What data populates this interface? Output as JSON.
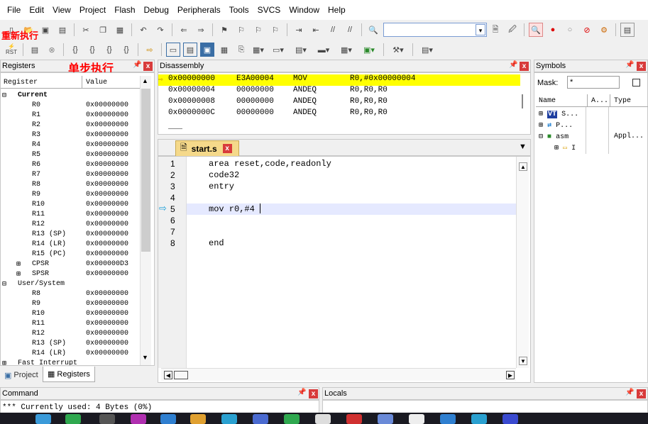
{
  "menu": [
    "File",
    "Edit",
    "View",
    "Project",
    "Flash",
    "Debug",
    "Peripherals",
    "Tools",
    "SVCS",
    "Window",
    "Help"
  ],
  "annotations": {
    "reset_run": "重新执行",
    "single_step": "单步执行"
  },
  "toolbar2": {
    "rst_label": "RST"
  },
  "registers_panel": {
    "title": "Registers",
    "col_register": "Register",
    "col_value": "Value",
    "groups": [
      {
        "label": "Current",
        "rows": [
          {
            "name": "R0",
            "value": "0x00000000"
          },
          {
            "name": "R1",
            "value": "0x00000000"
          },
          {
            "name": "R2",
            "value": "0x00000000"
          },
          {
            "name": "R3",
            "value": "0x00000000"
          },
          {
            "name": "R4",
            "value": "0x00000000"
          },
          {
            "name": "R5",
            "value": "0x00000000"
          },
          {
            "name": "R6",
            "value": "0x00000000"
          },
          {
            "name": "R7",
            "value": "0x00000000"
          },
          {
            "name": "R8",
            "value": "0x00000000"
          },
          {
            "name": "R9",
            "value": "0x00000000"
          },
          {
            "name": "R10",
            "value": "0x00000000"
          },
          {
            "name": "R11",
            "value": "0x00000000"
          },
          {
            "name": "R12",
            "value": "0x00000000"
          },
          {
            "name": "R13 (SP)",
            "value": "0x00000000"
          },
          {
            "name": "R14 (LR)",
            "value": "0x00000000"
          },
          {
            "name": "R15 (PC)",
            "value": "0x00000000"
          },
          {
            "name": "CPSR",
            "value": "0x000000D3"
          },
          {
            "name": "SPSR",
            "value": "0x00000000"
          }
        ]
      },
      {
        "label": "User/System",
        "rows": [
          {
            "name": "R8",
            "value": "0x00000000"
          },
          {
            "name": "R9",
            "value": "0x00000000"
          },
          {
            "name": "R10",
            "value": "0x00000000"
          },
          {
            "name": "R11",
            "value": "0x00000000"
          },
          {
            "name": "R12",
            "value": "0x00000000"
          },
          {
            "name": "R13 (SP)",
            "value": "0x00000000"
          },
          {
            "name": "R14 (LR)",
            "value": "0x00000000"
          }
        ]
      },
      {
        "label": "Fast Interrupt",
        "rows": []
      }
    ],
    "tabs": [
      "Project",
      "Registers"
    ]
  },
  "disassembly": {
    "title": "Disassembly",
    "rows": [
      {
        "addr": "0x00000000",
        "code": "E3A00004",
        "mnemonic": "MOV",
        "operands": "R0,#0x00000004",
        "current": true
      },
      {
        "addr": "0x00000004",
        "code": "00000000",
        "mnemonic": "ANDEQ",
        "operands": "R0,R0,R0",
        "current": false
      },
      {
        "addr": "0x00000008",
        "code": "00000000",
        "mnemonic": "ANDEQ",
        "operands": "R0,R0,R0",
        "current": false
      },
      {
        "addr": "0x0000000C",
        "code": "00000000",
        "mnemonic": "ANDEQ",
        "operands": "R0,R0,R0",
        "current": false
      }
    ]
  },
  "editor": {
    "tab_name": "start.s",
    "lines": [
      {
        "num": "1",
        "text": "area reset,code,readonly"
      },
      {
        "num": "2",
        "text": "code32"
      },
      {
        "num": "3",
        "text": "entry"
      },
      {
        "num": "4",
        "text": ""
      },
      {
        "num": "5",
        "text": "mov r0,#4"
      },
      {
        "num": "6",
        "text": ""
      },
      {
        "num": "7",
        "text": ""
      },
      {
        "num": "8",
        "text": "end"
      }
    ]
  },
  "symbols": {
    "title": "Symbols",
    "mask_label": "Mask:",
    "mask_value": "*",
    "col_name": "Name",
    "col_a": "A...",
    "col_type": "Type",
    "rows": [
      {
        "name": "S...",
        "type": ""
      },
      {
        "name": "P...",
        "type": ""
      },
      {
        "name": "asm",
        "type": "Appl..."
      }
    ]
  },
  "command": {
    "title": "Command",
    "text": "*** Currently used: 4 Bytes (0%)"
  },
  "locals": {
    "title": "Locals"
  },
  "colors": {
    "highlight": "#ffff00",
    "current_line": "#e5e9ff",
    "close": "#d83b3b",
    "annotation": "#ff0000"
  }
}
